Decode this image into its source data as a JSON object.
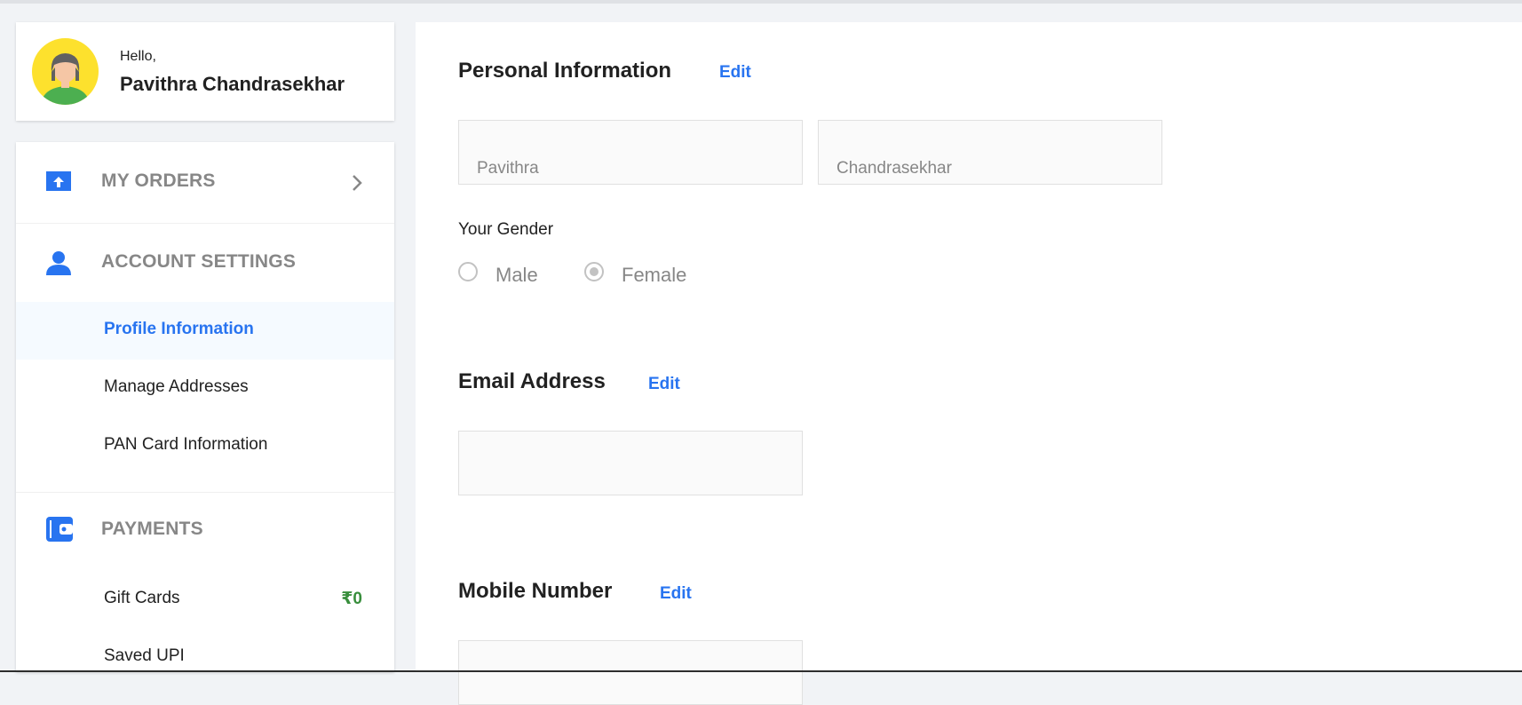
{
  "user": {
    "greeting": "Hello,",
    "name": "Pavithra Chandrasekhar"
  },
  "nav": {
    "my_orders": "MY ORDERS",
    "account_settings": {
      "label": "ACCOUNT SETTINGS",
      "items": [
        {
          "label": "Profile Information",
          "active": true
        },
        {
          "label": "Manage Addresses"
        },
        {
          "label": "PAN Card Information"
        }
      ]
    },
    "payments": {
      "label": "PAYMENTS",
      "items": [
        {
          "label": "Gift Cards",
          "value": "₹0"
        },
        {
          "label": "Saved UPI"
        }
      ]
    }
  },
  "personal": {
    "title": "Personal Information",
    "edit": "Edit",
    "first_name": "Pavithra",
    "last_name": "Chandrasekhar",
    "gender_label": "Your Gender",
    "gender_options": [
      "Male",
      "Female"
    ],
    "gender_selected": "Female"
  },
  "email": {
    "title": "Email Address",
    "edit": "Edit",
    "value": ""
  },
  "mobile": {
    "title": "Mobile Number",
    "edit": "Edit",
    "value": ""
  },
  "colors": {
    "accent": "#2874f0",
    "muted": "#878787",
    "green": "#388e3c",
    "avatar_bg": "#fde12d"
  },
  "icons": [
    "avatar-icon",
    "orders-icon",
    "chevron-right-icon",
    "user-icon",
    "wallet-icon",
    "radio-icon"
  ]
}
